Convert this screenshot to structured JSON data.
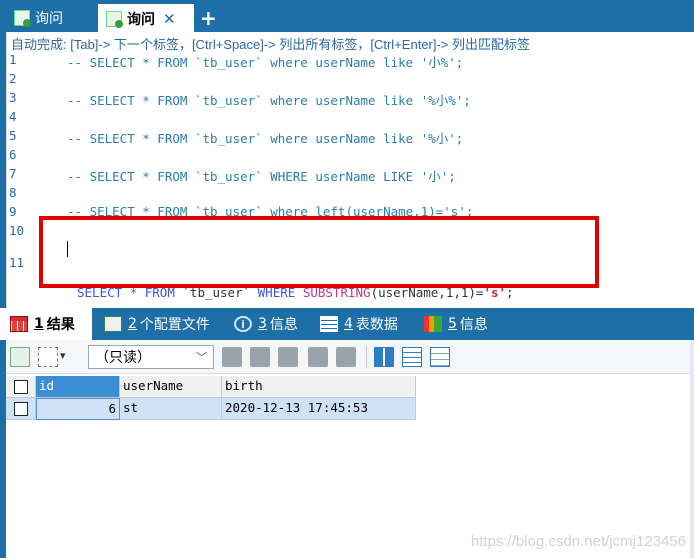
{
  "tabs": [
    {
      "label": "询问",
      "active": false
    },
    {
      "label": "询问",
      "active": true
    }
  ],
  "add_tab": "+",
  "close_glyph": "✕",
  "editor": {
    "hint": "自动完成: [Tab]-> 下一个标签，[Ctrl+Space]-> 列出所有标签，[Ctrl+Enter]-> 列出匹配标签",
    "lines": [
      {
        "num": "1",
        "text": "-- SELECT * FROM `tb_user` where userName like '小%';"
      },
      {
        "num": "2",
        "text": ""
      },
      {
        "num": "3",
        "text": "-- SELECT * FROM `tb_user` where userName like '%小%';"
      },
      {
        "num": "4",
        "text": ""
      },
      {
        "num": "5",
        "text": "-- SELECT * FROM `tb_user` where userName like '%小';"
      },
      {
        "num": "6",
        "text": ""
      },
      {
        "num": "7",
        "text": "-- SELECT * FROM `tb_user` WHERE userName LIKE '小';"
      },
      {
        "num": "8",
        "text": ""
      },
      {
        "num": "9",
        "text": "-- SELECT * FROM `tb_user` where left(userName,1)='s';"
      },
      {
        "num": "10",
        "text": ""
      },
      {
        "num": "11",
        "text": ""
      }
    ],
    "active_line": {
      "select": "SELECT",
      "star": "*",
      "from": "FROM",
      "table": "`tb_user`",
      "where": "WHERE",
      "fn": "SUBSTRING",
      "args": "(userName,1,1)=",
      "value": "'s'",
      "end": ";"
    }
  },
  "result_tabs": [
    {
      "num": "1",
      "label": "结果"
    },
    {
      "num": "2",
      "label": "个配置文件"
    },
    {
      "num": "3",
      "label": "信息"
    },
    {
      "num": "4",
      "label": "表数据"
    },
    {
      "num": "5",
      "label": "信息"
    }
  ],
  "toolbar": {
    "mode_select": "（只读）",
    "dropdown_arrow": "▾"
  },
  "grid": {
    "columns": [
      "id",
      "userName",
      "birth"
    ],
    "rows": [
      {
        "id": "6",
        "userName": "st",
        "birth": "2020-12-13 17:45:53"
      }
    ]
  },
  "watermark": "https://blog.csdn.net/jcmj123456",
  "colors": {
    "chrome_blue": "#1e6ea7",
    "highlight_red": "#e00000",
    "selected_row": "#cfe2f7"
  }
}
